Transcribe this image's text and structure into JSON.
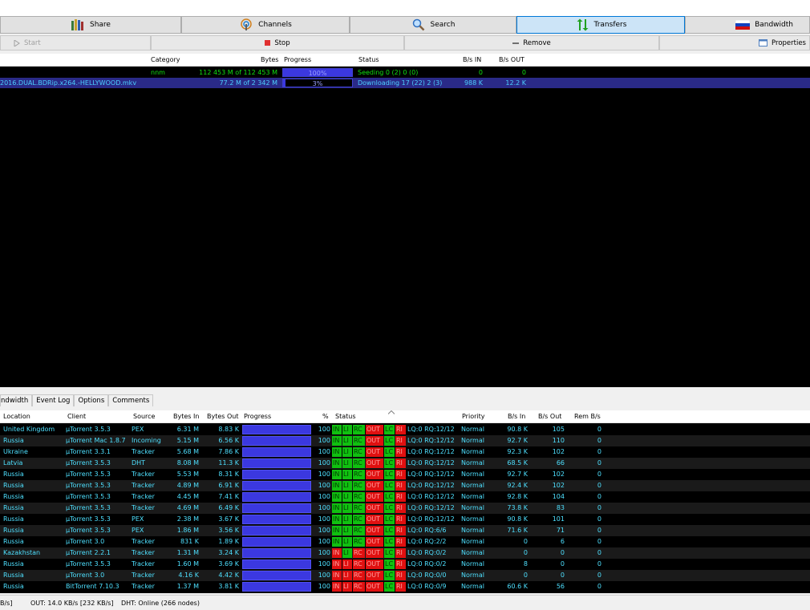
{
  "tabs": [
    {
      "label": "Share",
      "icon": "books-icon"
    },
    {
      "label": "Channels",
      "icon": "broadcast-icon"
    },
    {
      "label": "Search",
      "icon": "search-icon"
    },
    {
      "label": "Transfers",
      "icon": "transfer-arrows-icon"
    },
    {
      "label": "Bandwidth",
      "icon": "flag-icon"
    }
  ],
  "actions": {
    "start": "Start",
    "stop": "Stop",
    "remove": "Remove",
    "properties": "Properties"
  },
  "transfers": {
    "headers": {
      "category": "Category",
      "bytes": "Bytes",
      "progress": "Progress",
      "status": "Status",
      "bs_in": "B/s IN",
      "bs_out": "B/s OUT"
    },
    "rows": [
      {
        "name": "",
        "category": "nnm",
        "bytes": "112 453 M of 112 453 M",
        "progress": 100,
        "progress_label": "100%",
        "status": "Seeding 0 (2) 0 (0)",
        "bs_in": "0",
        "bs_out": "0"
      },
      {
        "name": "2016.DUAL.BDRip.x264.-HELLYWOOD.mkv",
        "category": "",
        "bytes": "77.2 M of 2 342 M",
        "progress": 3,
        "progress_label": "3%",
        "status": "Downloading 17 (22) 2 (3)",
        "bs_in": "988 K",
        "bs_out": "12.2 K"
      }
    ]
  },
  "subtabs": [
    "ndwidth",
    "Event Log",
    "Options",
    "Comments"
  ],
  "peers": {
    "headers": {
      "location": "Location",
      "client": "Client",
      "source": "Source",
      "bytes_in": "Bytes In",
      "bytes_out": "Bytes Out",
      "progress": "Progress",
      "pct": "%",
      "status": "Status",
      "priority": "Priority",
      "bs_in": "B/s In",
      "bs_out": "B/s Out",
      "rem": "Rem B/s"
    },
    "rows": [
      {
        "location": "United Kingdom",
        "client": "µTorrent 3.5.3",
        "source": "PEX",
        "bytes_in": "6.31 M",
        "bytes_out": "8.83 K",
        "pct": "100",
        "in": "g",
        "li": "g",
        "rc": "g",
        "out": "r",
        "lc": "g",
        "ri": "r",
        "lq": "LQ:0 RQ:12/12",
        "priority": "Normal",
        "bs_in": "90.8 K",
        "bs_out": "105",
        "rem": "0"
      },
      {
        "location": "Russia",
        "client": "µTorrent Mac 1.8.7",
        "source": "Incoming",
        "bytes_in": "5.15 M",
        "bytes_out": "6.56 K",
        "pct": "100",
        "in": "g",
        "li": "g",
        "rc": "g",
        "out": "r",
        "lc": "g",
        "ri": "r",
        "lq": "LQ:0 RQ:12/12",
        "priority": "Normal",
        "bs_in": "92.7 K",
        "bs_out": "110",
        "rem": "0"
      },
      {
        "location": "Ukraine",
        "client": "µTorrent 3.3.1",
        "source": "Tracker",
        "bytes_in": "5.68 M",
        "bytes_out": "7.86 K",
        "pct": "100",
        "in": "g",
        "li": "g",
        "rc": "g",
        "out": "r",
        "lc": "g",
        "ri": "r",
        "lq": "LQ:0 RQ:12/12",
        "priority": "Normal",
        "bs_in": "92.3 K",
        "bs_out": "102",
        "rem": "0"
      },
      {
        "location": "Latvia",
        "client": "µTorrent 3.5.3",
        "source": "DHT",
        "bytes_in": "8.08 M",
        "bytes_out": "11.3 K",
        "pct": "100",
        "in": "g",
        "li": "g",
        "rc": "g",
        "out": "r",
        "lc": "g",
        "ri": "r",
        "lq": "LQ:0 RQ:12/12",
        "priority": "Normal",
        "bs_in": "68.5 K",
        "bs_out": "66",
        "rem": "0"
      },
      {
        "location": "Russia",
        "client": "µTorrent 3.5.3",
        "source": "Tracker",
        "bytes_in": "5.53 M",
        "bytes_out": "8.31 K",
        "pct": "100",
        "in": "g",
        "li": "g",
        "rc": "g",
        "out": "r",
        "lc": "g",
        "ri": "r",
        "lq": "LQ:0 RQ:12/12",
        "priority": "Normal",
        "bs_in": "92.7 K",
        "bs_out": "102",
        "rem": "0"
      },
      {
        "location": "Russia",
        "client": "µTorrent 3.5.3",
        "source": "Tracker",
        "bytes_in": "4.89 M",
        "bytes_out": "6.91 K",
        "pct": "100",
        "in": "g",
        "li": "g",
        "rc": "g",
        "out": "r",
        "lc": "g",
        "ri": "r",
        "lq": "LQ:0 RQ:12/12",
        "priority": "Normal",
        "bs_in": "92.4 K",
        "bs_out": "102",
        "rem": "0"
      },
      {
        "location": "Russia",
        "client": "µTorrent 3.5.3",
        "source": "Tracker",
        "bytes_in": "4.45 M",
        "bytes_out": "7.41 K",
        "pct": "100",
        "in": "g",
        "li": "g",
        "rc": "g",
        "out": "r",
        "lc": "g",
        "ri": "r",
        "lq": "LQ:0 RQ:12/12",
        "priority": "Normal",
        "bs_in": "92.8 K",
        "bs_out": "104",
        "rem": "0"
      },
      {
        "location": "Russia",
        "client": "µTorrent 3.5.3",
        "source": "Tracker",
        "bytes_in": "4.69 M",
        "bytes_out": "6.49 K",
        "pct": "100",
        "in": "g",
        "li": "g",
        "rc": "g",
        "out": "r",
        "lc": "g",
        "ri": "r",
        "lq": "LQ:0 RQ:12/12",
        "priority": "Normal",
        "bs_in": "73.8 K",
        "bs_out": "83",
        "rem": "0"
      },
      {
        "location": "Russia",
        "client": "µTorrent 3.5.3",
        "source": "PEX",
        "bytes_in": "2.38 M",
        "bytes_out": "3.67 K",
        "pct": "100",
        "in": "g",
        "li": "g",
        "rc": "g",
        "out": "r",
        "lc": "g",
        "ri": "r",
        "lq": "LQ:0 RQ:12/12",
        "priority": "Normal",
        "bs_in": "90.8 K",
        "bs_out": "101",
        "rem": "0"
      },
      {
        "location": "Russia",
        "client": "µTorrent 3.5.3",
        "source": "PEX",
        "bytes_in": "1.86 M",
        "bytes_out": "3.56 K",
        "pct": "100",
        "in": "g",
        "li": "g",
        "rc": "g",
        "out": "r",
        "lc": "g",
        "ri": "r",
        "lq": "LQ:0 RQ:6/6",
        "priority": "Normal",
        "bs_in": "71.6 K",
        "bs_out": "71",
        "rem": "0"
      },
      {
        "location": "Russia",
        "client": "µTorrent 3.0",
        "source": "Tracker",
        "bytes_in": "831 K",
        "bytes_out": "1.89 K",
        "pct": "100",
        "in": "g",
        "li": "g",
        "rc": "g",
        "out": "r",
        "lc": "g",
        "ri": "r",
        "lq": "LQ:0 RQ:2/2",
        "priority": "Normal",
        "bs_in": "0",
        "bs_out": "6",
        "rem": "0"
      },
      {
        "location": "Kazakhstan",
        "client": "µTorrent 2.2.1",
        "source": "Tracker",
        "bytes_in": "1.31 M",
        "bytes_out": "3.24 K",
        "pct": "100",
        "in": "r",
        "li": "g",
        "rc": "r",
        "out": "r",
        "lc": "g",
        "ri": "r",
        "lq": "LQ:0 RQ:0/2",
        "priority": "Normal",
        "bs_in": "0",
        "bs_out": "0",
        "rem": "0"
      },
      {
        "location": "Russia",
        "client": "µTorrent 3.5.3",
        "source": "Tracker",
        "bytes_in": "1.60 M",
        "bytes_out": "3.69 K",
        "pct": "100",
        "in": "r",
        "li": "r",
        "rc": "r",
        "out": "r",
        "lc": "g",
        "ri": "r",
        "lq": "LQ:0 RQ:0/2",
        "priority": "Normal",
        "bs_in": "8",
        "bs_out": "0",
        "rem": "0"
      },
      {
        "location": "Russia",
        "client": "µTorrent 3.0",
        "source": "Tracker",
        "bytes_in": "4.16 K",
        "bytes_out": "4.42 K",
        "pct": "100",
        "in": "r",
        "li": "r",
        "rc": "r",
        "out": "r",
        "lc": "g",
        "ri": "r",
        "lq": "LQ:0 RQ:0/0",
        "priority": "Normal",
        "bs_in": "0",
        "bs_out": "0",
        "rem": "0"
      },
      {
        "location": "Russia",
        "client": "BitTorrent 7.10.3",
        "source": "Tracker",
        "bytes_in": "1.37 M",
        "bytes_out": "3.81 K",
        "pct": "100",
        "in": "r",
        "li": "r",
        "rc": "r",
        "out": "r",
        "lc": "g",
        "ri": "r",
        "lq": "LQ:0 RQ:0/9",
        "priority": "Normal",
        "bs_in": "60.6 K",
        "bs_out": "56",
        "rem": "0"
      }
    ],
    "flag_labels": {
      "in": "IN",
      "li": "LI",
      "rc": "RC",
      "out": "OUT",
      "lc": "LC",
      "ri": "RI"
    }
  },
  "statusbar": {
    "in_part": "B/s]",
    "out": "OUT: 14.0 KB/s [232 KB/s]",
    "dht": "DHT: Online (266 nodes)"
  },
  "colors": {
    "list_bg": "#000000",
    "peer_text": "#4ee0ff",
    "transfer_text": "#10e010",
    "selected_row": "#2a2a88",
    "progress_fill": "#3b38e0",
    "flag_green": "#10c010",
    "flag_red": "#e01010"
  }
}
